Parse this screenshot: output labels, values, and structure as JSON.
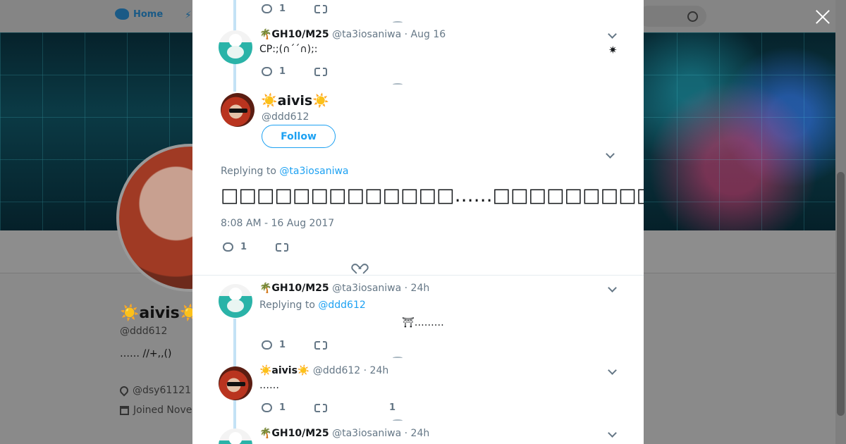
{
  "background": {
    "nav_home_label": "Home",
    "profile_name": "☀️aivis☀️",
    "profile_handle": "@ddd612",
    "profile_bio": "……  //+,,()",
    "profile_location": "@dsy61121",
    "profile_joined": "Joined Nove"
  },
  "modal": {
    "tweets": [
      {
        "reply_count": "1"
      },
      {
        "name": "🌴GH10/M25",
        "meta": "@ta3iosaniwa · Aug 16",
        "text": "CP:;(∩´´∩);:",
        "reply_count": "1"
      }
    ],
    "main": {
      "name": "☀️aivis☀️",
      "handle": "@ddd612",
      "follow_label": "Follow",
      "replying_label": "Replying to",
      "replying_handle": "@ta3iosaniwa",
      "text": "□□□□□□□□□□□□□……□□□□□□□□□□□□□□□□□□□□□□□□□□🎉🎉□□□□□💥",
      "timestamp": "8:08 AM - 16 Aug 2017",
      "reply_count": "1"
    },
    "replies": [
      {
        "name": "🌴GH10/M25",
        "meta": "@ta3iosaniwa · 24h",
        "replying_label": "Replying to",
        "replying_handle": "@ddd612",
        "text": "⛩………",
        "reply_count": "1"
      },
      {
        "name": "☀️aivis☀️",
        "meta": "@ddd612 · 24h",
        "text": "……",
        "reply_count": "1",
        "like_count": "1"
      },
      {
        "name": "🌴GH10/M25",
        "meta": "@ta3iosaniwa · 24h"
      }
    ]
  },
  "colors": {
    "accent": "#1da1f2",
    "muted": "#657786",
    "thread_line": "#c4e2f5"
  },
  "icons": [
    "close-icon",
    "reply-icon",
    "retweet-icon",
    "like-icon",
    "chevron-down-icon",
    "location-icon",
    "calendar-icon",
    "twitter-bird-icon",
    "search-icon"
  ]
}
